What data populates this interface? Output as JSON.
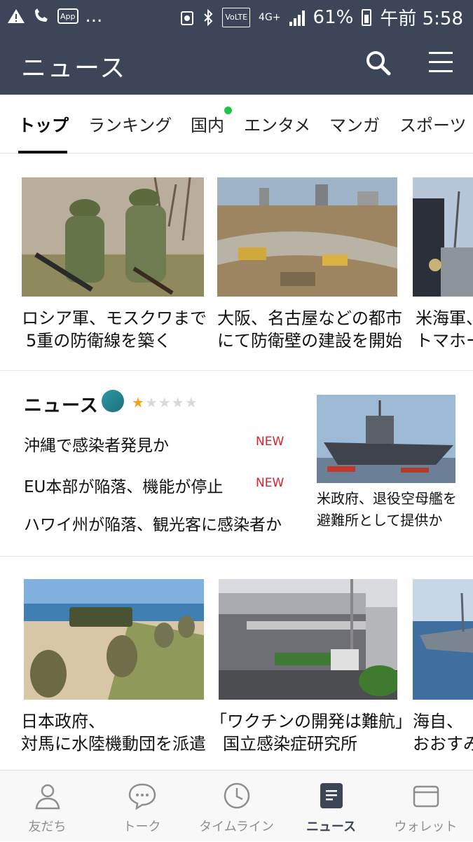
{
  "status_bar": {
    "battery": "61%",
    "time": "午前 5:58",
    "network": "4G+",
    "volte": "VoLTE",
    "app_badge": "App",
    "ellipsis": "..."
  },
  "header": {
    "title": "ニュース"
  },
  "tabs": [
    {
      "label": "トップ",
      "active": true
    },
    {
      "label": "ランキング"
    },
    {
      "label": "国内",
      "dot": true
    },
    {
      "label": "エンタメ"
    },
    {
      "label": "マンガ"
    },
    {
      "label": "スポーツ"
    }
  ],
  "top_cards": [
    {
      "line1": "ロシア軍、モスクワまで",
      "line2": "5重の防衛線を築く",
      "image": "soldiers-photo"
    },
    {
      "line1": "大阪、名古屋などの都市",
      "line2": "にて防衛壁の建設を開始",
      "image": "construction-site-photo"
    },
    {
      "line1": "米海軍、",
      "line2": "トマホー",
      "image": "navy-ship-photo"
    }
  ],
  "digest": {
    "title": "ニュース",
    "rating": 1,
    "max_rating": 5,
    "headlines": [
      {
        "text": "沖縄で感染者発見か",
        "badge": "NEW"
      },
      {
        "text": "EU本部が陥落、機能が停止",
        "badge": "NEW"
      },
      {
        "text": "ハワイ州が陥落、観光客に感染者か",
        "badge": ""
      }
    ],
    "feature": {
      "line1": "米政府、退役空母艦を",
      "line2": "避難所として提供か",
      "image": "aircraft-carrier-photo"
    }
  },
  "bottom_cards": [
    {
      "line1": "日本政府、",
      "line2": "対馬に水陸機動団を派遣",
      "image": "amphibious-troops-photo"
    },
    {
      "line1": "「ワクチンの開発は難航」",
      "line2": "国立感染症研究所",
      "image": "institute-building-photo"
    },
    {
      "line1": "海自、",
      "line2": "おおすみ",
      "image": "warship-photo"
    }
  ],
  "bottom_nav": [
    {
      "label": "友だち",
      "icon": "person-icon"
    },
    {
      "label": "トーク",
      "icon": "chat-bubble-icon"
    },
    {
      "label": "タイムライン",
      "icon": "clock-icon"
    },
    {
      "label": "ニュース",
      "icon": "news-icon",
      "active": true
    },
    {
      "label": "ウォレット",
      "icon": "wallet-icon"
    }
  ],
  "colors": {
    "header_bg": "#3d4558",
    "new_badge": "#d8212f",
    "tab_dot": "#1ec34b",
    "star_on": "#f2a21b"
  }
}
